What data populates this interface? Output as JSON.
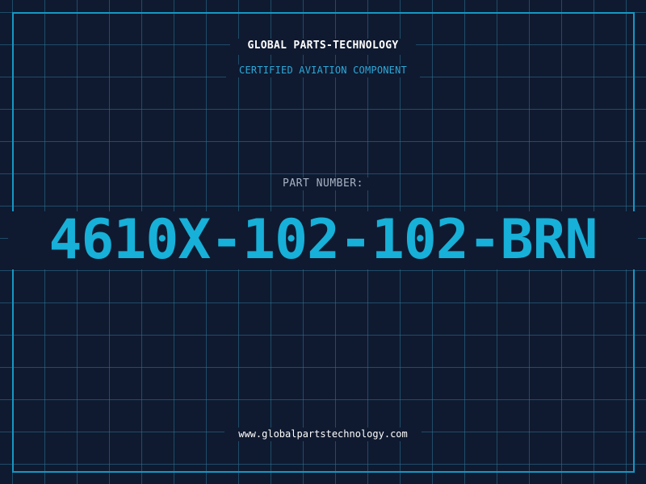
{
  "header": {
    "company": "GLOBAL PARTS-TECHNOLOGY",
    "subtitle": "CERTIFIED AVIATION COMPONENT"
  },
  "part": {
    "label": "PART NUMBER:",
    "number": "4610X-102-102-BRN"
  },
  "footer": {
    "url": "www.globalpartstechnology.com"
  },
  "colors": {
    "background": "#0f1a30",
    "grid": "#2c7496",
    "frame": "#1597c4",
    "accent": "#17b0d8",
    "subtitle": "#2ea8d8",
    "label": "#a7b2c4",
    "text": "#ffffff"
  }
}
